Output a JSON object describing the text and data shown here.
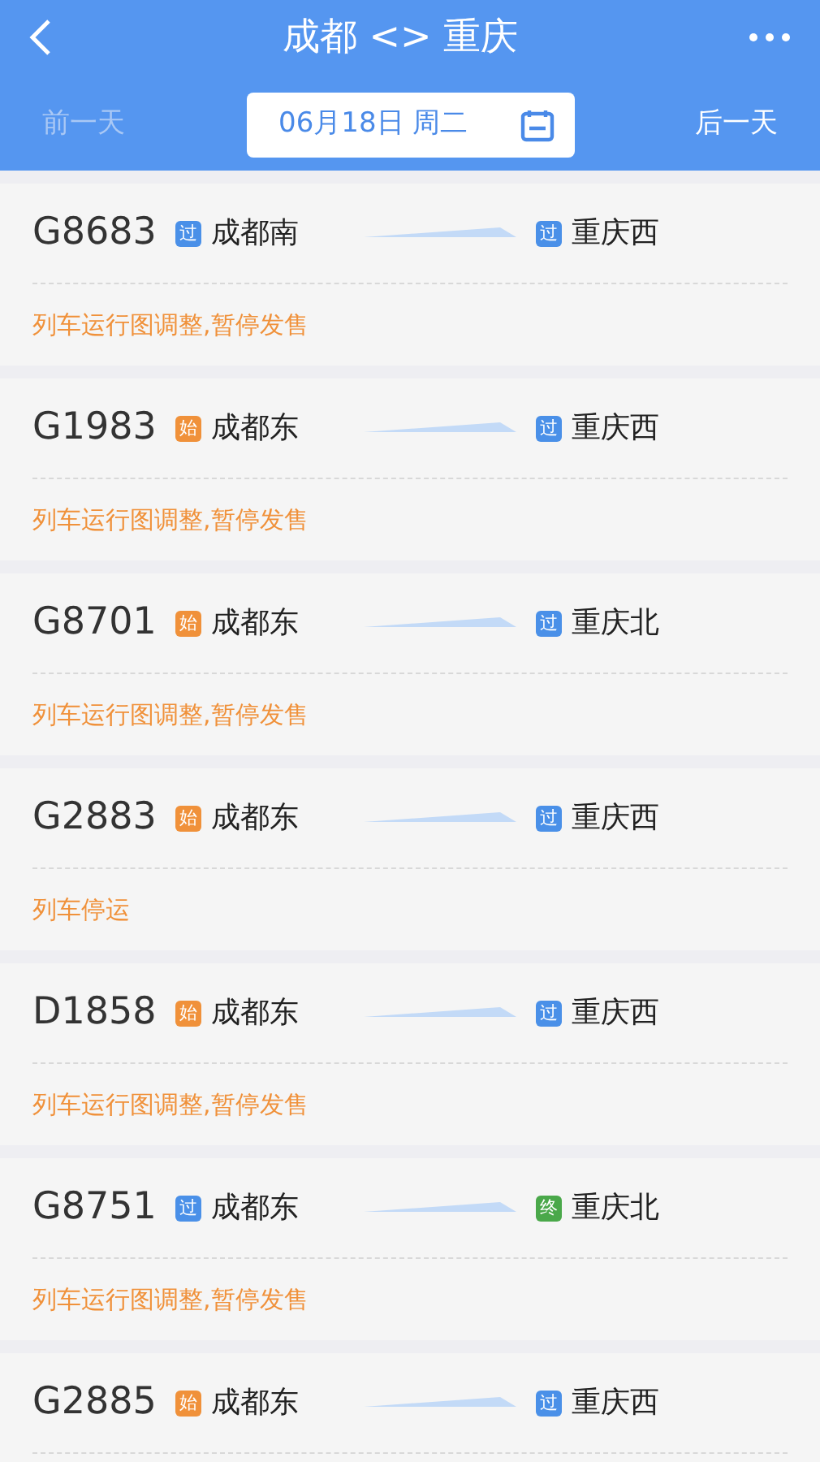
{
  "header": {
    "title": "成都 <> 重庆",
    "prev_day": {
      "label": "前一天",
      "disabled": true
    },
    "date": "06月18日 周二",
    "next_day": {
      "label": "后一天",
      "disabled": false
    }
  },
  "trains": [
    {
      "number": "G8683",
      "from": {
        "badge": "过",
        "kind": "pass",
        "station": "成都南"
      },
      "to": {
        "badge": "过",
        "kind": "pass",
        "station": "重庆西"
      },
      "status": "列车运行图调整,暂停发售"
    },
    {
      "number": "G1983",
      "from": {
        "badge": "始",
        "kind": "start",
        "station": "成都东"
      },
      "to": {
        "badge": "过",
        "kind": "pass",
        "station": "重庆西"
      },
      "status": "列车运行图调整,暂停发售"
    },
    {
      "number": "G8701",
      "from": {
        "badge": "始",
        "kind": "start",
        "station": "成都东"
      },
      "to": {
        "badge": "过",
        "kind": "pass",
        "station": "重庆北"
      },
      "status": "列车运行图调整,暂停发售"
    },
    {
      "number": "G2883",
      "from": {
        "badge": "始",
        "kind": "start",
        "station": "成都东"
      },
      "to": {
        "badge": "过",
        "kind": "pass",
        "station": "重庆西"
      },
      "status": "列车停运"
    },
    {
      "number": "D1858",
      "from": {
        "badge": "始",
        "kind": "start",
        "station": "成都东"
      },
      "to": {
        "badge": "过",
        "kind": "pass",
        "station": "重庆西"
      },
      "status": "列车运行图调整,暂停发售"
    },
    {
      "number": "G8751",
      "from": {
        "badge": "过",
        "kind": "pass",
        "station": "成都东"
      },
      "to": {
        "badge": "终",
        "kind": "end",
        "station": "重庆北"
      },
      "status": "列车运行图调整,暂停发售"
    },
    {
      "number": "G2885",
      "from": {
        "badge": "始",
        "kind": "start",
        "station": "成都东"
      },
      "to": {
        "badge": "过",
        "kind": "pass",
        "station": "重庆西"
      }
    }
  ]
}
